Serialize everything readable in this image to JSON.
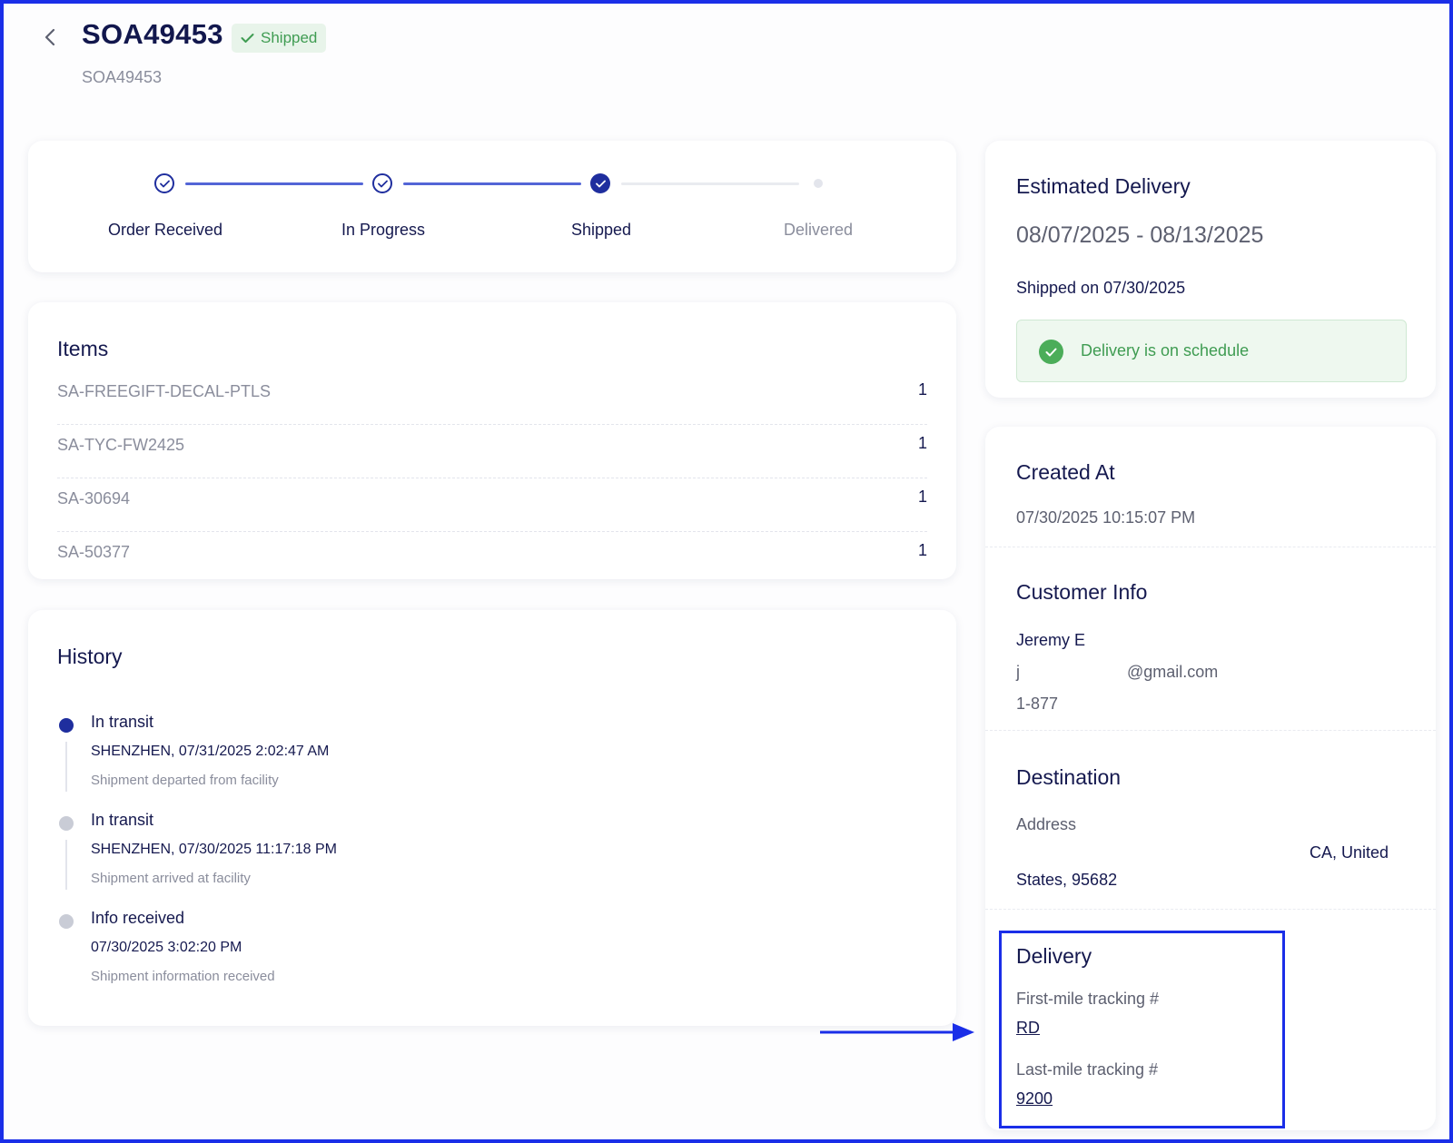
{
  "header": {
    "title": "SOA49453",
    "status": "Shipped",
    "subtitle": "SOA49453"
  },
  "progress": {
    "steps": [
      {
        "label": "Order Received",
        "state": "done"
      },
      {
        "label": "In Progress",
        "state": "done"
      },
      {
        "label": "Shipped",
        "state": "current"
      },
      {
        "label": "Delivered",
        "state": "pending"
      }
    ]
  },
  "items": {
    "title": "Items",
    "rows": [
      {
        "sku": "SA-FREEGIFT-DECAL-PTLS",
        "qty": "1"
      },
      {
        "sku": "SA-TYC-FW2425",
        "qty": "1"
      },
      {
        "sku": "SA-30694",
        "qty": "1"
      },
      {
        "sku": "SA-50377",
        "qty": "1"
      }
    ]
  },
  "history": {
    "title": "History",
    "entries": [
      {
        "status": "In transit",
        "location": "SHENZHEN, 07/31/2025 2:02:47 AM",
        "description": "Shipment departed from facility",
        "active": true
      },
      {
        "status": "In transit",
        "location": "SHENZHEN, 07/30/2025 11:17:18 PM",
        "description": "Shipment arrived at facility",
        "active": false
      },
      {
        "status": "Info received",
        "location": "07/30/2025 3:02:20 PM",
        "description": "Shipment information received",
        "active": false
      }
    ]
  },
  "estimate": {
    "title": "Estimated Delivery",
    "range": "08/07/2025 - 08/13/2025",
    "shipped_on": "Shipped on 07/30/2025",
    "schedule": "Delivery is on schedule"
  },
  "created": {
    "title": "Created At",
    "value": "07/30/2025 10:15:07 PM"
  },
  "customer": {
    "title": "Customer Info",
    "name": "Jeremy E",
    "email_prefix": "j",
    "email_domain": "@gmail.com",
    "phone": "1-877"
  },
  "destination": {
    "title": "Destination",
    "address_label": "Address",
    "line1": "CA, United",
    "line2": "States, 95682"
  },
  "delivery": {
    "title": "Delivery",
    "first_mile_label": "First-mile tracking #",
    "first_mile_value": "RD",
    "last_mile_label": "Last-mile tracking #",
    "last_mile_value": "9200"
  },
  "colors": {
    "primary": "#1f2e9e",
    "success": "#3f9c52",
    "annotation": "#1a2ee8"
  }
}
